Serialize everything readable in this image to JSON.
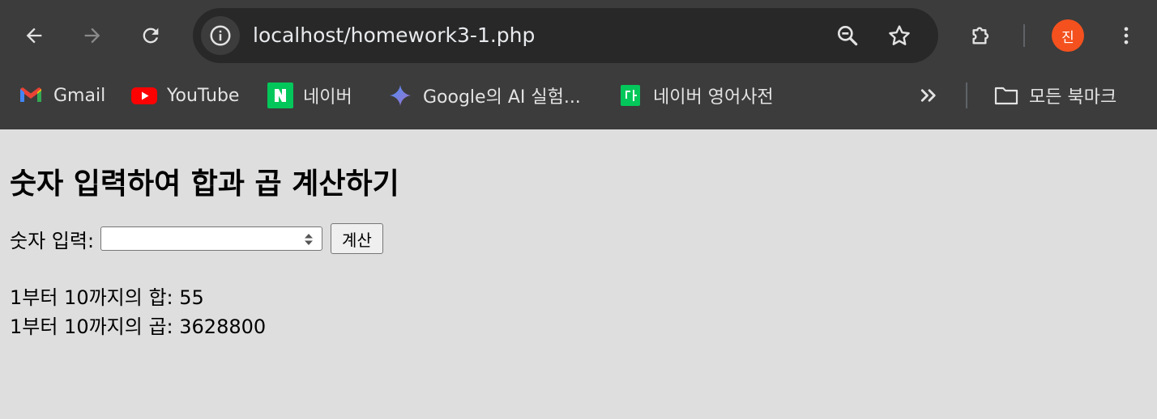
{
  "browser": {
    "url": "localhost/homework3-1.php",
    "profile_initial": "진",
    "bookmarks": [
      {
        "label": "Gmail",
        "icon": "gmail-icon"
      },
      {
        "label": "YouTube",
        "icon": "youtube-icon"
      },
      {
        "label": "네이버",
        "icon": "naver-icon"
      },
      {
        "label": "Google의 AI 실험...",
        "icon": "gemini-sparkle-icon"
      },
      {
        "label": "네이버 영어사전",
        "icon": "naver-dictionary-icon"
      }
    ],
    "all_bookmarks_label": "모든 북마크",
    "colors": {
      "chrome_bg": "#3c3c3c",
      "omnibox_bg": "#282828",
      "avatar": "#f4511e"
    }
  },
  "page": {
    "title": "숫자 입력하여 합과 곱 계산하기",
    "input_label": "숫자 입력:",
    "input_value": "",
    "button_label": "계산",
    "results": [
      "1부터 10까지의 합: 55",
      "1부터 10까지의 곱: 3628800"
    ],
    "background": "#dedede"
  }
}
